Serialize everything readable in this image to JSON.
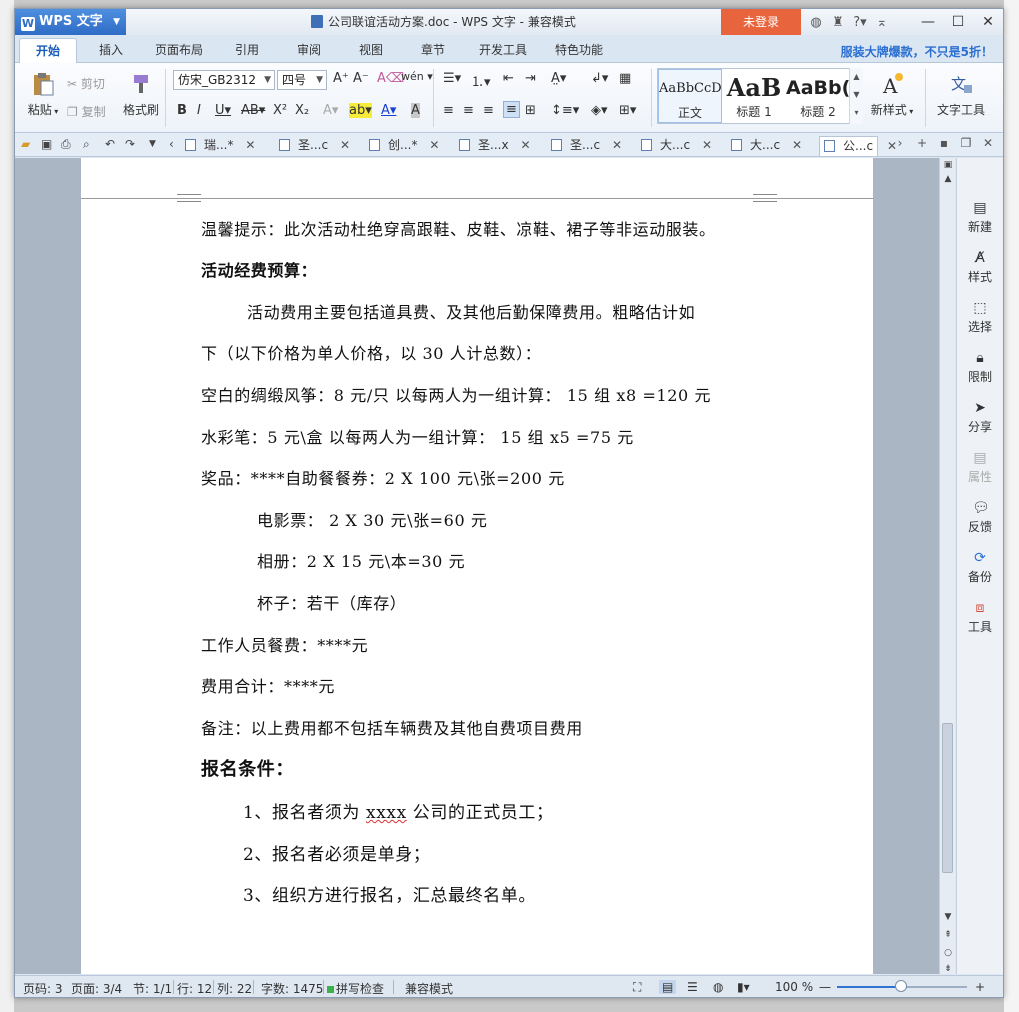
{
  "app": {
    "button_label": "WPS 文字",
    "window_title": "公司联谊活动方案.doc - WPS 文字 - 兼容模式",
    "login_label": "未登录"
  },
  "menu": {
    "tabs": [
      "开始",
      "插入",
      "页面布局",
      "引用",
      "审阅",
      "视图",
      "章节",
      "开发工具",
      "特色功能"
    ],
    "promo": "服装大牌爆款，不只是5折！"
  },
  "ribbon": {
    "paste": "粘贴",
    "cut": "剪切",
    "copy": "复制",
    "format_painter": "格式刷",
    "font_name": "仿宋_GB2312",
    "font_size": "四号",
    "styles": [
      {
        "preview": "AaBbCcD",
        "label": "正文"
      },
      {
        "preview": "AaB",
        "label": "标题 1"
      },
      {
        "preview": "AaBb(",
        "label": "标题 2"
      }
    ],
    "new_style": "新样式",
    "text_tools": "文字工具"
  },
  "doc_tabs": [
    {
      "label": "瑞...*"
    },
    {
      "label": "圣...c"
    },
    {
      "label": "创...*"
    },
    {
      "label": "圣...x"
    },
    {
      "label": "圣...c"
    },
    {
      "label": "大...c"
    },
    {
      "label": "大...c"
    },
    {
      "label": "公...c"
    }
  ],
  "document": {
    "lines": [
      "温馨提示：此次活动杜绝穿高跟鞋、皮鞋、凉鞋、裙子等非运动服装。",
      "活动经费预算：",
      "活动费用主要包括道具费、及其他后勤保障费用。粗略估计如",
      "下（以下价格为单人价格，以 30 人计总数）：",
      "空白的绸缎风筝：8 元/只   以每两人为一组计算： 15 组 x8 =120 元",
      "水彩笔：5 元\\盒     以每两人为一组计算： 15 组 x5 =75 元",
      "奖品：****自助餐餐券：2 X 100 元\\张=200 元",
      "电影票： 2  X 30 元\\张=60 元",
      "相册：2 X 15 元\\本=30 元",
      "杯子：若干（库存）",
      "工作人员餐费：****元",
      "费用合计：****元",
      "备注：以上费用都不包括车辆费及其他自费项目费用",
      "报名条件：",
      "1、报名者须为",
      "xxxx",
      "公司的正式员工；",
      "2、报名者必须是单身；",
      "3、组织方进行报名，汇总最终名单。"
    ]
  },
  "task_pane": [
    "新建",
    "样式",
    "选择",
    "限制",
    "分享",
    "属性",
    "反馈",
    "备份",
    "工具"
  ],
  "status": {
    "page": "页码: 3",
    "pages": "页面: 3/4",
    "section": "节: 1/1",
    "row": "行: 12",
    "col": "列: 22",
    "words": "字数: 1475",
    "spell": "拼写检查",
    "mode": "兼容模式",
    "zoom": "100 %",
    "zoom_level": 1.0
  }
}
